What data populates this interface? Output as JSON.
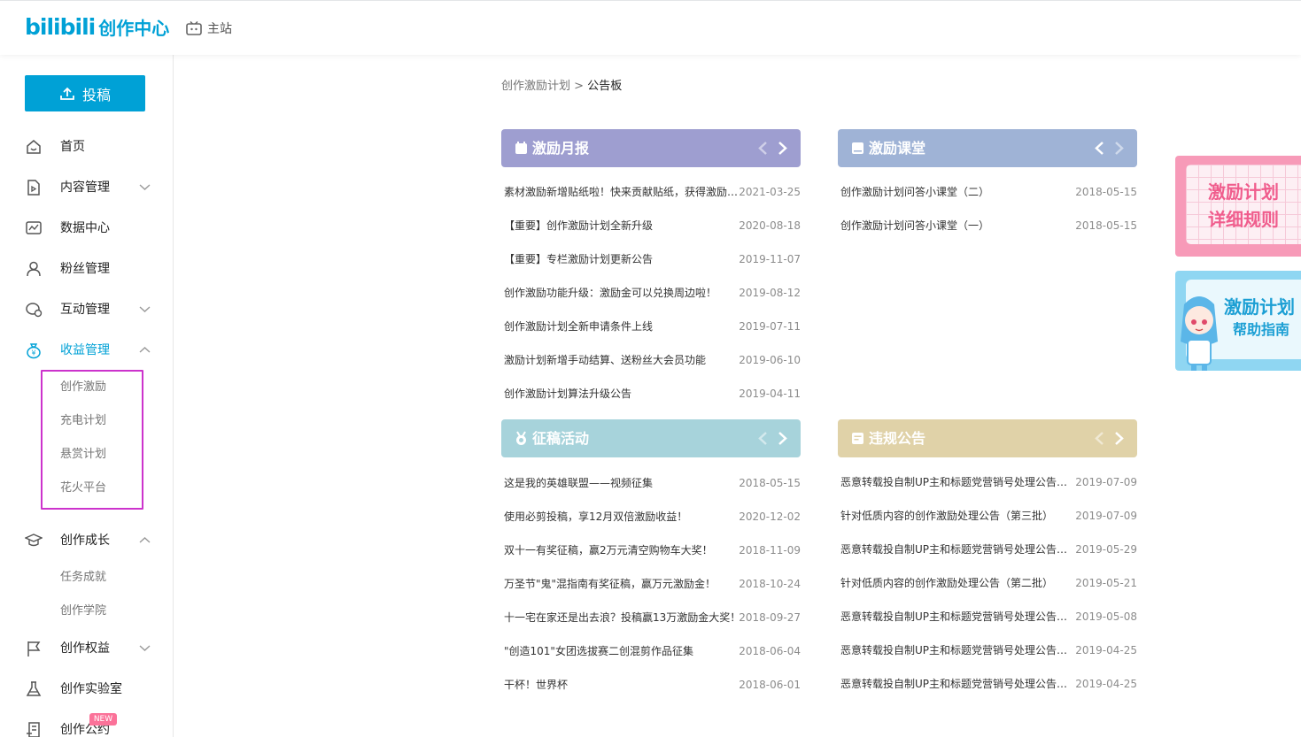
{
  "header": {
    "logo_mark": "bilibili",
    "logo_text": "创作中心",
    "main_site": "主站"
  },
  "sidebar": {
    "upload_label": "投稿",
    "items": [
      {
        "label": "首页"
      },
      {
        "label": "内容管理"
      },
      {
        "label": "数据中心"
      },
      {
        "label": "粉丝管理"
      },
      {
        "label": "互动管理"
      },
      {
        "label": "收益管理"
      },
      {
        "label": "创作成长"
      },
      {
        "label": "创作权益"
      },
      {
        "label": "创作实验室"
      },
      {
        "label": "创作公约"
      }
    ],
    "income_sub": [
      "创作激励",
      "充电计划",
      "悬赏计划",
      "花火平台"
    ],
    "growth_sub": [
      "任务成就",
      "创作学院"
    ],
    "new_badge": "NEW"
  },
  "breadcrumb": {
    "parent": "创作激励计划",
    "sep": ">",
    "current": "公告板"
  },
  "cards": [
    {
      "title": "激励月报",
      "color": "#9e9ed0",
      "items": [
        {
          "title": "素材激励新增贴纸啦！快来贡献贴纸，获得激励金吧",
          "date": "2021-03-25"
        },
        {
          "title": "【重要】创作激励计划全新升级",
          "date": "2020-08-18"
        },
        {
          "title": "【重要】专栏激励计划更新公告",
          "date": "2019-11-07"
        },
        {
          "title": "创作激励功能升级：激励金可以兑换周边啦！",
          "date": "2019-08-12"
        },
        {
          "title": "创作激励计划全新申请条件上线",
          "date": "2019-07-11"
        },
        {
          "title": "激励计划新增手动结算、送粉丝大会员功能",
          "date": "2019-06-10"
        },
        {
          "title": "创作激励计划算法升级公告",
          "date": "2019-04-11"
        }
      ]
    },
    {
      "title": "激励课堂",
      "color": "#9fb3d6",
      "items": [
        {
          "title": "创作激励计划问答小课堂（二）",
          "date": "2018-05-15"
        },
        {
          "title": "创作激励计划问答小课堂（一）",
          "date": "2018-05-15"
        }
      ]
    },
    {
      "title": "征稿活动",
      "color": "#a7d3db",
      "items": [
        {
          "title": "这是我的英雄联盟——视频征集",
          "date": "2018-05-15"
        },
        {
          "title": "使用必剪投稿，享12月双倍激励收益！",
          "date": "2020-12-02"
        },
        {
          "title": "双十一有奖征稿，赢2万元清空购物车大奖！",
          "date": "2018-11-09"
        },
        {
          "title": "万圣节\"鬼\"混指南有奖征稿，赢万元激励金！",
          "date": "2018-10-24"
        },
        {
          "title": "十一宅在家还是出去浪？投稿赢13万激励金大奖！",
          "date": "2018-09-27"
        },
        {
          "title": "\"创造101\"女团选拔赛二创混剪作品征集",
          "date": "2018-06-04"
        },
        {
          "title": "干杯！世界杯",
          "date": "2018-06-01"
        }
      ]
    },
    {
      "title": "违规公告",
      "color": "#e0d2a8",
      "items": [
        {
          "title": "恶意转载投自制UP主和标题党营销号处理公告（七）",
          "date": "2019-07-09"
        },
        {
          "title": "针对低质内容的创作激励处理公告（第三批）",
          "date": "2019-07-09"
        },
        {
          "title": "恶意转载投自制UP主和标题党营销号处理公告（六）",
          "date": "2019-05-29"
        },
        {
          "title": "针对低质内容的创作激励处理公告（第二批）",
          "date": "2019-05-21"
        },
        {
          "title": "恶意转载投自制UP主和标题党营销号处理公告（五）",
          "date": "2019-05-08"
        },
        {
          "title": "恶意转载投自制UP主和标题党营销号处理公告（四）",
          "date": "2019-04-25"
        },
        {
          "title": "恶意转载投自制UP主和标题党营销号处理公告（三）",
          "date": "2019-04-25"
        }
      ]
    }
  ],
  "banners": {
    "rules_line1": "激励计划",
    "rules_line2": "详细规则",
    "help_line1": "激励计划",
    "help_line2": "帮助指南"
  },
  "colors": {
    "accent": "#00a1d6",
    "highlight_box": "#cc33cc",
    "badge": "#fb7299"
  }
}
